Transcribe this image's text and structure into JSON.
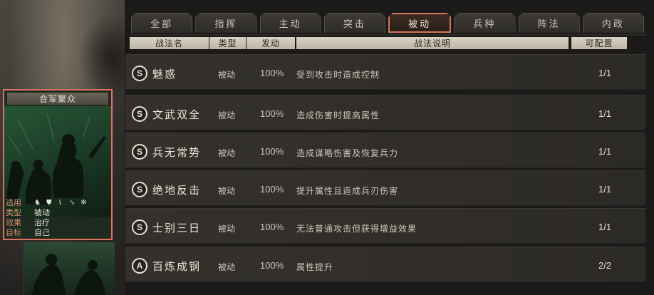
{
  "tabs": [
    {
      "label": "全部",
      "active": false
    },
    {
      "label": "指挥",
      "active": false
    },
    {
      "label": "主动",
      "active": false
    },
    {
      "label": "突击",
      "active": false
    },
    {
      "label": "被动",
      "active": true
    },
    {
      "label": "兵种",
      "active": false
    },
    {
      "label": "阵法",
      "active": false
    },
    {
      "label": "内政",
      "active": false
    }
  ],
  "columns": {
    "name": "战法名",
    "type": "类型",
    "rate": "发动",
    "desc": "战法说明",
    "count": "可配置"
  },
  "rows": [
    {
      "grade": "S",
      "name": "魅惑",
      "type": "被动",
      "rate": "100%",
      "desc": "受到攻击时造成控制",
      "count": "1/1"
    },
    {
      "grade": "S",
      "name": "文武双全",
      "type": "被动",
      "rate": "100%",
      "desc": "造成伤害时提高属性",
      "count": "1/1"
    },
    {
      "grade": "S",
      "name": "兵无常势",
      "type": "被动",
      "rate": "100%",
      "desc": "造成谋略伤害及恢复兵力",
      "count": "1/1"
    },
    {
      "grade": "S",
      "name": "绝地反击",
      "type": "被动",
      "rate": "100%",
      "desc": "提升属性且造成兵刃伤害",
      "count": "1/1"
    },
    {
      "grade": "S",
      "name": "士别三日",
      "type": "被动",
      "rate": "100%",
      "desc": "无法普通攻击但获得增益效果",
      "count": "1/1"
    },
    {
      "grade": "A",
      "name": "百炼成钢",
      "type": "被动",
      "rate": "100%",
      "desc": "属性提升",
      "count": "2/2"
    }
  ],
  "card": {
    "title": "合军聚众",
    "applicable_label": "适用",
    "applicable_icons": [
      "cavalry-icon",
      "shield-icon",
      "bow-icon",
      "spear-icon",
      "wheel-icon"
    ],
    "type_label": "类型",
    "type_value": "被动",
    "effect_label": "效果",
    "effect_value": "治疗",
    "target_label": "目标",
    "target_value": "自己"
  },
  "colors": {
    "active_tab_border": "#d6765d",
    "card_border": "#e0705f",
    "label_accent": "#d98c6e"
  }
}
